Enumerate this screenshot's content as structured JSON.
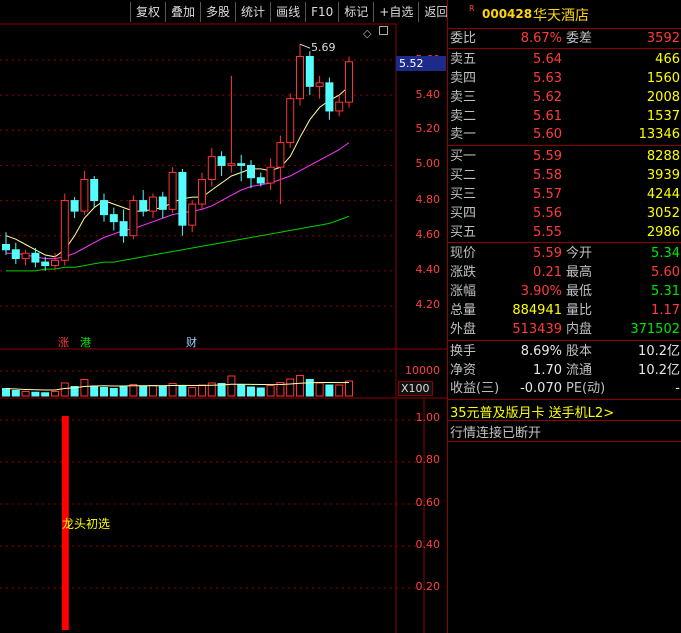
{
  "toolbar": {
    "buttons": [
      "复权",
      "叠加",
      "多股",
      "统计",
      "画线",
      "F10",
      "标记",
      "+自选",
      "返回"
    ]
  },
  "stock": {
    "mark": "R",
    "code": "000428",
    "name": "华天酒店"
  },
  "order_ratio": {
    "label1": "委比",
    "value1": "8.67%",
    "label2": "委差",
    "value2": "3592"
  },
  "asks": [
    {
      "label": "卖五",
      "price": "5.64",
      "volume": "466"
    },
    {
      "label": "卖四",
      "price": "5.63",
      "volume": "1560"
    },
    {
      "label": "卖三",
      "price": "5.62",
      "volume": "2008"
    },
    {
      "label": "卖二",
      "price": "5.61",
      "volume": "1537"
    },
    {
      "label": "卖一",
      "price": "5.60",
      "volume": "13346"
    }
  ],
  "bids": [
    {
      "label": "买一",
      "price": "5.59",
      "volume": "8288"
    },
    {
      "label": "买二",
      "price": "5.58",
      "volume": "3939"
    },
    {
      "label": "买三",
      "price": "5.57",
      "volume": "4244"
    },
    {
      "label": "买四",
      "price": "5.56",
      "volume": "3052"
    },
    {
      "label": "买五",
      "price": "5.55",
      "volume": "2986"
    }
  ],
  "quote": [
    {
      "l1": "现价",
      "v1": "5.59",
      "l2": "今开",
      "v2": "5.34"
    },
    {
      "l1": "涨跌",
      "v1": "0.21",
      "l2": "最高",
      "v2": "5.60"
    },
    {
      "l1": "涨幅",
      "v1": "3.90%",
      "l2": "最低",
      "v2": "5.31"
    },
    {
      "l1": "总量",
      "v1": "884941",
      "l2": "量比",
      "v2": "1.17"
    },
    {
      "l1": "外盘",
      "v1": "513439",
      "l2": "内盘",
      "v2": "371502"
    }
  ],
  "finance": [
    {
      "l1": "换手",
      "v1": "8.69%",
      "l2": "股本",
      "v2": "10.2亿"
    },
    {
      "l1": "净资",
      "v1": "1.70",
      "l2": "流通",
      "v2": "10.2亿"
    },
    {
      "l1": "收益(三)",
      "v1": "-0.070",
      "l2": "PE(动)",
      "v2": "-"
    }
  ],
  "promo": "35元普及版月卡 送手机L2>",
  "status": "行情连接已断开",
  "chart_data": {
    "type": "candlestick",
    "price_axis": [
      "5.60",
      "5.40",
      "5.20",
      "5.00",
      "4.80",
      "4.60",
      "4.40",
      "4.20"
    ],
    "current_price_tag": "5.52",
    "high_annotation": "5.69",
    "markers": [
      "涨",
      "港",
      "财"
    ],
    "volume_axis": "10000",
    "volume_unit": "X100",
    "signal_axis": [
      "1.00",
      "0.80",
      "0.60",
      "0.40",
      "0.20"
    ],
    "signal_label": "龙头初选",
    "candles": [
      {
        "o": 4.55,
        "h": 4.62,
        "l": 4.49,
        "c": 4.52
      },
      {
        "o": 4.52,
        "h": 4.56,
        "l": 4.44,
        "c": 4.47
      },
      {
        "o": 4.47,
        "h": 4.52,
        "l": 4.43,
        "c": 4.5
      },
      {
        "o": 4.5,
        "h": 4.53,
        "l": 4.42,
        "c": 4.45
      },
      {
        "o": 4.45,
        "h": 4.48,
        "l": 4.4,
        "c": 4.43
      },
      {
        "o": 4.43,
        "h": 4.5,
        "l": 4.41,
        "c": 4.46
      },
      {
        "o": 4.46,
        "h": 4.84,
        "l": 4.43,
        "c": 4.8
      },
      {
        "o": 4.8,
        "h": 4.82,
        "l": 4.7,
        "c": 4.74
      },
      {
        "o": 4.74,
        "h": 4.97,
        "l": 4.72,
        "c": 4.92
      },
      {
        "o": 4.92,
        "h": 4.94,
        "l": 4.76,
        "c": 4.8
      },
      {
        "o": 4.8,
        "h": 4.84,
        "l": 4.68,
        "c": 4.72
      },
      {
        "o": 4.72,
        "h": 4.76,
        "l": 4.63,
        "c": 4.68
      },
      {
        "o": 4.68,
        "h": 4.75,
        "l": 4.56,
        "c": 4.6
      },
      {
        "o": 4.6,
        "h": 4.83,
        "l": 4.58,
        "c": 4.8
      },
      {
        "o": 4.8,
        "h": 4.86,
        "l": 4.71,
        "c": 4.74
      },
      {
        "o": 4.74,
        "h": 4.84,
        "l": 4.7,
        "c": 4.82
      },
      {
        "o": 4.82,
        "h": 4.85,
        "l": 4.7,
        "c": 4.75
      },
      {
        "o": 4.75,
        "h": 4.99,
        "l": 4.73,
        "c": 4.96
      },
      {
        "o": 4.96,
        "h": 4.98,
        "l": 4.6,
        "c": 4.66
      },
      {
        "o": 4.66,
        "h": 4.8,
        "l": 4.62,
        "c": 4.78
      },
      {
        "o": 4.78,
        "h": 4.96,
        "l": 4.75,
        "c": 4.92
      },
      {
        "o": 4.92,
        "h": 5.1,
        "l": 4.88,
        "c": 5.05
      },
      {
        "o": 5.05,
        "h": 5.08,
        "l": 4.94,
        "c": 5.0
      },
      {
        "o": 5.0,
        "h": 5.51,
        "l": 4.96,
        "c": 5.01
      },
      {
        "o": 5.01,
        "h": 5.06,
        "l": 4.91,
        "c": 5.0
      },
      {
        "o": 5.0,
        "h": 5.03,
        "l": 4.87,
        "c": 4.93
      },
      {
        "o": 4.93,
        "h": 4.96,
        "l": 4.88,
        "c": 4.9
      },
      {
        "o": 4.9,
        "h": 5.04,
        "l": 4.86,
        "c": 4.99
      },
      {
        "o": 4.99,
        "h": 5.17,
        "l": 4.78,
        "c": 5.13
      },
      {
        "o": 5.13,
        "h": 5.41,
        "l": 5.1,
        "c": 5.38
      },
      {
        "o": 5.38,
        "h": 5.69,
        "l": 5.34,
        "c": 5.62
      },
      {
        "o": 5.62,
        "h": 5.65,
        "l": 5.4,
        "c": 5.45
      },
      {
        "o": 5.45,
        "h": 5.51,
        "l": 5.38,
        "c": 5.47
      },
      {
        "o": 5.47,
        "h": 5.5,
        "l": 5.26,
        "c": 5.31
      },
      {
        "o": 5.31,
        "h": 5.4,
        "l": 5.28,
        "c": 5.36
      },
      {
        "o": 5.36,
        "h": 5.62,
        "l": 5.33,
        "c": 5.59
      }
    ],
    "ma_short": [
      4.6,
      4.58,
      4.55,
      4.52,
      4.49,
      4.48,
      4.52,
      4.6,
      4.7,
      4.76,
      4.8,
      4.78,
      4.76,
      4.74,
      4.74,
      4.75,
      4.76,
      4.79,
      4.81,
      4.82,
      4.82,
      4.86,
      4.9,
      4.94,
      4.96,
      4.98,
      4.98,
      4.97,
      4.99,
      5.05,
      5.16,
      5.26,
      5.33,
      5.37,
      5.4,
      5.45
    ],
    "ma_mid": [
      4.5,
      4.5,
      4.49,
      4.48,
      4.47,
      4.47,
      4.48,
      4.5,
      4.53,
      4.56,
      4.59,
      4.61,
      4.63,
      4.64,
      4.66,
      4.68,
      4.7,
      4.72,
      4.73,
      4.74,
      4.75,
      4.77,
      4.8,
      4.83,
      4.86,
      4.88,
      4.89,
      4.9,
      4.92,
      4.94,
      4.97,
      5.0,
      5.03,
      5.06,
      5.09,
      5.13
    ],
    "ma_long": [
      4.4,
      4.4,
      4.4,
      4.4,
      4.41,
      4.41,
      4.42,
      4.42,
      4.43,
      4.44,
      4.45,
      4.45,
      4.46,
      4.47,
      4.48,
      4.49,
      4.5,
      4.51,
      4.52,
      4.53,
      4.54,
      4.55,
      4.56,
      4.57,
      4.58,
      4.59,
      4.6,
      4.61,
      4.62,
      4.63,
      4.64,
      4.65,
      4.66,
      4.67,
      4.69,
      4.71
    ],
    "volumes": [
      3000,
      2200,
      1800,
      1500,
      1300,
      1800,
      5200,
      3800,
      6600,
      4000,
      3400,
      3000,
      3600,
      4600,
      3800,
      4200,
      3800,
      5000,
      4200,
      3400,
      4400,
      5200,
      5000,
      8000,
      4400,
      3600,
      3200,
      4200,
      5400,
      6800,
      8200,
      6600,
      5200,
      4400,
      4400,
      6000
    ],
    "volume_ma": [
      3000,
      2800,
      2600,
      2500,
      2400,
      2400,
      3000,
      3300,
      3800,
      4000,
      4100,
      4000,
      4000,
      4100,
      4100,
      4150,
      4100,
      4200,
      4250,
      4200,
      4200,
      4300,
      4400,
      4700,
      4700,
      4650,
      4600,
      4550,
      4600,
      4800,
      5100,
      5300,
      5400,
      5400,
      5350,
      5400
    ],
    "signal_bar_value": 1.0,
    "signal_bar_index": 6
  },
  "colors": {
    "up": "#ff3333",
    "down": "#54fcfc",
    "ma_short": "#ffff99",
    "ma_mid": "#ff33ff",
    "ma_long": "#00d000",
    "grid": "#8b0000"
  }
}
